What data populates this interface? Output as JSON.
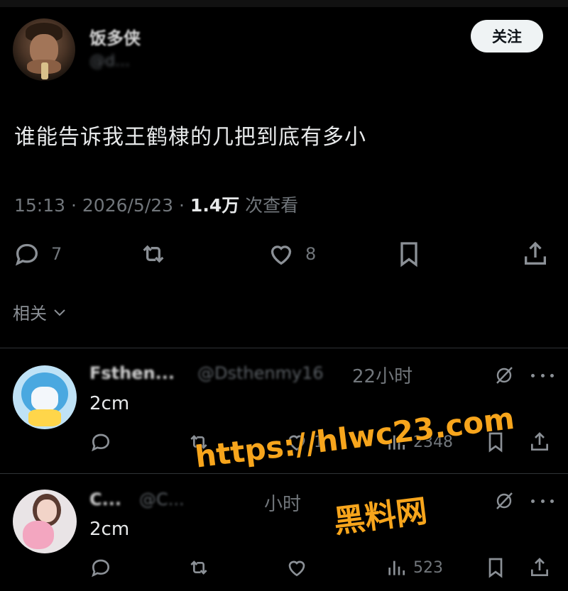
{
  "post": {
    "author_name": "饭多侠",
    "author_handle": "@d...",
    "follow_label": "关注",
    "text": "谁能告诉我王鹤棣的几把到底有多小",
    "time": "15:13 · 2026/5/23 · ",
    "views_count": "1.4万",
    "views_label": " 次查看",
    "replies": "7",
    "likes": "8"
  },
  "related_label": "相关",
  "replies": [
    {
      "name": "Fsthen...",
      "handle": "@Dsthenmy16",
      "time": "22小时",
      "text": "2cm",
      "likes": "1",
      "views": "2348"
    },
    {
      "name": "C...",
      "handle": "@C...",
      "time": "小时",
      "text": "2cm",
      "likes": "",
      "views": "523"
    }
  ],
  "watermark": {
    "url": "https://hlwc23.com",
    "name": "黑料网"
  }
}
